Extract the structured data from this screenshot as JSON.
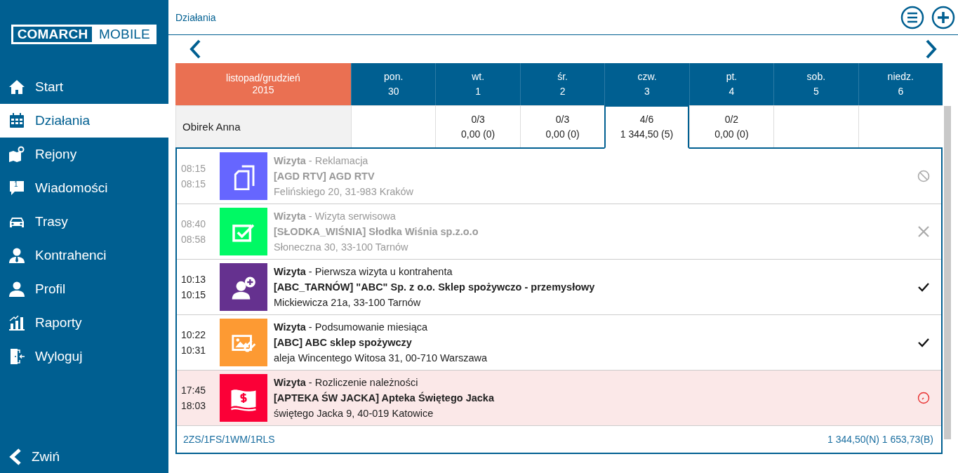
{
  "logo": {
    "left": "COMARCH",
    "right": "MOBILE"
  },
  "sidebar": {
    "items": [
      {
        "kind": "home",
        "label": "Start",
        "selected": false
      },
      {
        "kind": "calendar",
        "label": "Działania",
        "selected": true
      },
      {
        "kind": "map",
        "label": "Rejony",
        "selected": false
      },
      {
        "kind": "messages",
        "label": "Wiadomości",
        "selected": false,
        "badge": "1"
      },
      {
        "kind": "car",
        "label": "Trasy",
        "selected": false
      },
      {
        "kind": "contacts",
        "label": "Kontrahenci",
        "selected": false
      },
      {
        "kind": "profile",
        "label": "Profil",
        "selected": false
      },
      {
        "kind": "chart",
        "label": "Raporty",
        "selected": false
      },
      {
        "kind": "logout",
        "label": "Wyloguj",
        "selected": false
      }
    ],
    "collapse": "Zwiń"
  },
  "header": {
    "title": "Działania"
  },
  "calendar": {
    "period": {
      "months": "listopad/grudzień",
      "year": "2015"
    },
    "person": "Obirek Anna",
    "days": [
      {
        "name": "pon.",
        "number": "30",
        "selected": false
      },
      {
        "name": "wt.",
        "number": "1",
        "selected": false,
        "count": "0/3",
        "amount": "0,00 (0)"
      },
      {
        "name": "śr.",
        "number": "2",
        "selected": false,
        "count": "0/3",
        "amount": "0,00 (0)"
      },
      {
        "name": "czw.",
        "number": "3",
        "selected": true,
        "count": "4/6",
        "amount": "1 344,50 (5)"
      },
      {
        "name": "pt.",
        "number": "4",
        "selected": false,
        "count": "0/2",
        "amount": "0,00 (0)"
      },
      {
        "name": "sob.",
        "number": "5",
        "selected": false
      },
      {
        "name": "niedz.",
        "number": "6",
        "selected": false
      }
    ]
  },
  "visits": [
    {
      "kind": "document",
      "color": "#6666ff",
      "start": "08:15",
      "end": "08:15",
      "title": "**Wizyta** - Reklamacja",
      "client": "[AGD RTV] AGD RTV",
      "address": "Felińskiego 20, 31-983 Kraków",
      "completed": false,
      "cancelled": true,
      "rejected": false,
      "overdue": false
    },
    {
      "kind": "task",
      "color": "#00f964",
      "start": "08:40",
      "end": "08:58",
      "title": "**Wizyta** - Wizyta serwisowa",
      "client": "[SŁODKA_WIŚNIA] Słodka Wiśnia sp.z.o.o",
      "address": "Słoneczna 30, 33-100 Tarnów",
      "completed": false,
      "cancelled": false,
      "rejected": true,
      "overdue": false
    },
    {
      "kind": "person",
      "color": "#65318f",
      "start": "10:13",
      "end": "10:15",
      "title": "**Wizyta** - Pierwsza wizyta u kontrahenta",
      "client": "[ABC_TARNÓW] \"ABC\" Sp. z o.o. Sklep spożywczo - przemysłowy",
      "address": "Mickiewicza 21a, 33-100 Tarnów",
      "completed": true,
      "cancelled": false,
      "rejected": false,
      "overdue": false
    },
    {
      "kind": "attachment",
      "color": "#fd9a33",
      "start": "10:22",
      "end": "10:31",
      "title": "**Wizyta** - Podsumowanie miesiąca",
      "client": "[ABC] ABC sklep spożywczy",
      "address": "aleja Wincentego Witosa 31, 00-710 Warszawa",
      "completed": true,
      "cancelled": false,
      "rejected": false,
      "overdue": false
    },
    {
      "kind": "payment",
      "color": "#fb0037",
      "start": "17:45",
      "end": "18:03",
      "title": "**Wizyta** - Rozliczenie należności",
      "client": "[APTEKA ŚW JACKA] Apteka Świętego Jacka",
      "address": "świętego Jacka 9, 40-019 Katowice",
      "completed": false,
      "cancelled": false,
      "rejected": false,
      "overdue": true
    }
  ],
  "summary": {
    "counts": "2ZS/1FS/1WM/1RLS",
    "totals": "1 344,50(N) 1 653,73(B)"
  }
}
